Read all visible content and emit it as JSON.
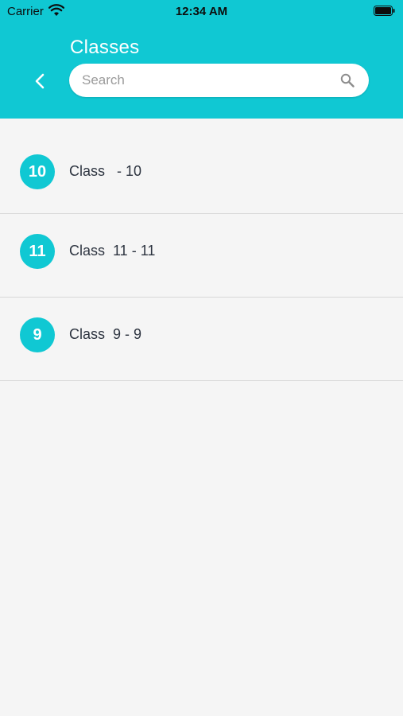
{
  "status_bar": {
    "carrier": "Carrier",
    "time": "12:34 AM"
  },
  "header": {
    "title": "Classes",
    "back_icon": "chevron-left-icon"
  },
  "search": {
    "placeholder": "Search",
    "value": "",
    "icon": "search-icon"
  },
  "colors": {
    "accent": "#10c8d3",
    "background": "#f5f5f5",
    "divider": "#d8d8d8",
    "text": "#2d3440"
  },
  "classes": {
    "items": [
      {
        "badge": "10",
        "label": "Class   - 10"
      },
      {
        "badge": "11",
        "label": "Class  11 - 11"
      },
      {
        "badge": "9",
        "label": "Class  9 - 9"
      }
    ]
  }
}
